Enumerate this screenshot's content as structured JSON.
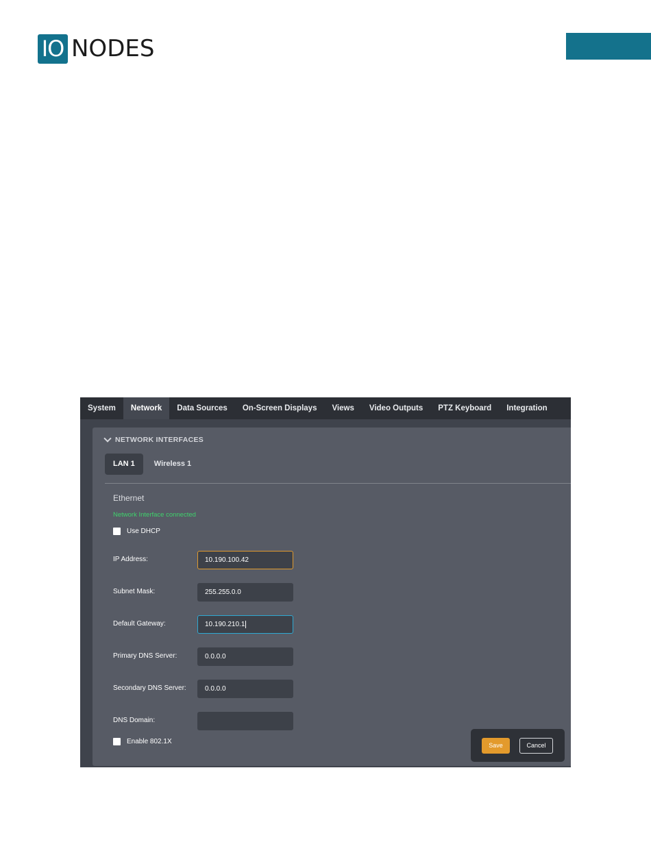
{
  "brand": {
    "logo_box_text": "IO",
    "logo_text": "NODES",
    "colors": {
      "brand": "#14728c",
      "save": "#e39a2c",
      "status_ok": "#3fd26c"
    }
  },
  "nav": {
    "tabs": [
      {
        "label": "System"
      },
      {
        "label": "Network",
        "active": true
      },
      {
        "label": "Data Sources"
      },
      {
        "label": "On-Screen Displays"
      },
      {
        "label": "Views"
      },
      {
        "label": "Video Outputs"
      },
      {
        "label": "PTZ Keyboard"
      },
      {
        "label": "Integration"
      }
    ]
  },
  "section": {
    "title": "NETWORK INTERFACES",
    "chevron_icon": "chevron-down-icon"
  },
  "interface_tabs": [
    {
      "label": "LAN 1",
      "active": true
    },
    {
      "label": "Wireless 1"
    }
  ],
  "ethernet": {
    "title": "Ethernet",
    "status": "Network Interface connected",
    "use_dhcp": {
      "label": "Use DHCP",
      "checked": false
    },
    "fields": {
      "ip_address": {
        "label": "IP Address:",
        "value": "10.190.100.42"
      },
      "subnet_mask": {
        "label": "Subnet Mask:",
        "value": "255.255.0.0"
      },
      "default_gateway": {
        "label": "Default Gateway:",
        "value": "10.190.210.1"
      },
      "primary_dns": {
        "label": "Primary DNS Server:",
        "value": "0.0.0.0"
      },
      "secondary_dns": {
        "label": "Secondary DNS Server:",
        "value": "0.0.0.0"
      },
      "dns_domain": {
        "label": "DNS Domain:",
        "value": ""
      }
    },
    "enable_8021x": {
      "label": "Enable 802.1X",
      "checked": false
    }
  },
  "actions": {
    "save_label": "Save",
    "cancel_label": "Cancel"
  }
}
